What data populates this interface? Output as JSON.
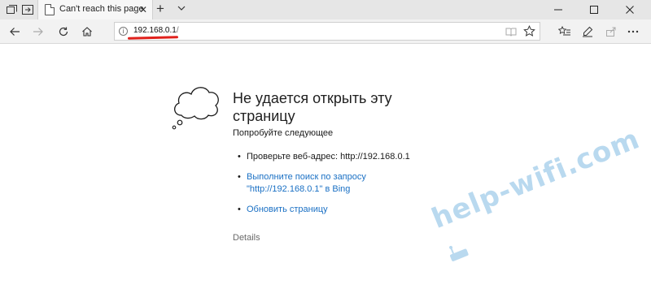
{
  "tab": {
    "title": "Can't reach this page"
  },
  "address": {
    "host": "192.168.0.1",
    "rest": "/"
  },
  "error": {
    "title": "Не удается открыть эту страницу",
    "try_label": "Попробуйте следующее",
    "items": {
      "check_address": "Проверьте веб-адрес: http://192.168.0.1",
      "search_line1": "Выполните поиск по запросу",
      "search_line2": "\"http://192.168.0.1\" в Bing",
      "refresh": "Обновить страницу"
    },
    "details": "Details"
  },
  "watermark": {
    "text": "help-wifi.com"
  },
  "colors": {
    "link": "#1a70c4",
    "annotation": "#e0201b",
    "watermark": "#b9d9ef"
  }
}
